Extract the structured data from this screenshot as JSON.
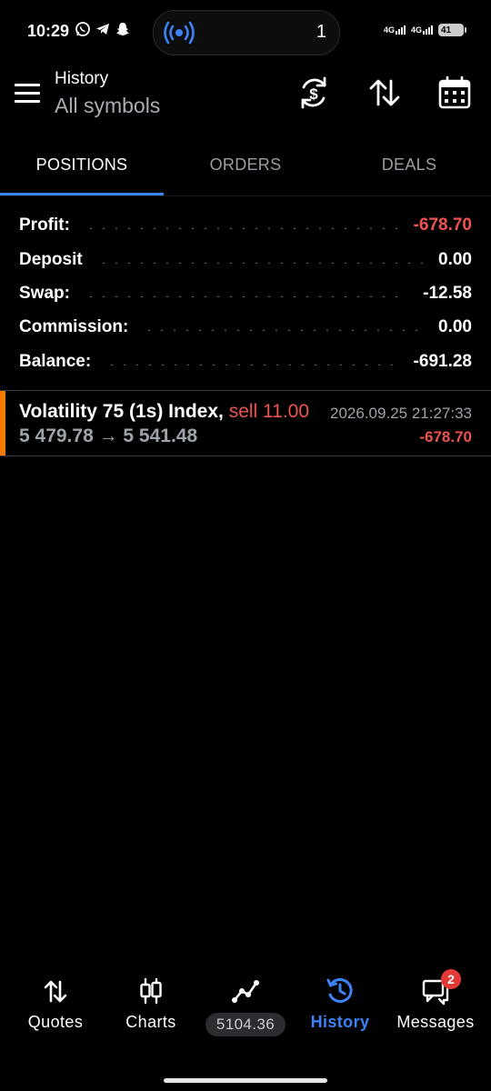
{
  "status_bar": {
    "time": "10:29",
    "notification_count": "1",
    "network_1": "4G",
    "network_2": "4G",
    "battery": "41"
  },
  "header": {
    "title": "History",
    "subtitle": "All symbols"
  },
  "tabs": [
    {
      "label": "POSITIONS",
      "active": true
    },
    {
      "label": "ORDERS",
      "active": false
    },
    {
      "label": "DEALS",
      "active": false
    }
  ],
  "summary": [
    {
      "label": "Profit:",
      "value": "-678.70"
    },
    {
      "label": "Deposit",
      "value": "0.00"
    },
    {
      "label": "Swap:",
      "value": "-12.58"
    },
    {
      "label": "Commission:",
      "value": "0.00"
    },
    {
      "label": "Balance:",
      "value": "-691.28"
    }
  ],
  "position": {
    "symbol": "Volatility 75 (1s) Index,",
    "side": "sell 11.00",
    "prices": "5 479.78 → 5 541.48",
    "time": "2026.09.25 21:27:33",
    "profit": "-678.70"
  },
  "nav": {
    "quotes": "Quotes",
    "charts": "Charts",
    "trade_price": "5104.36",
    "history": "History",
    "messages": "Messages",
    "messages_badge": "2"
  },
  "colors": {
    "accent": "#3b82f6",
    "negative": "#ef5350",
    "marker": "#f57c00"
  }
}
